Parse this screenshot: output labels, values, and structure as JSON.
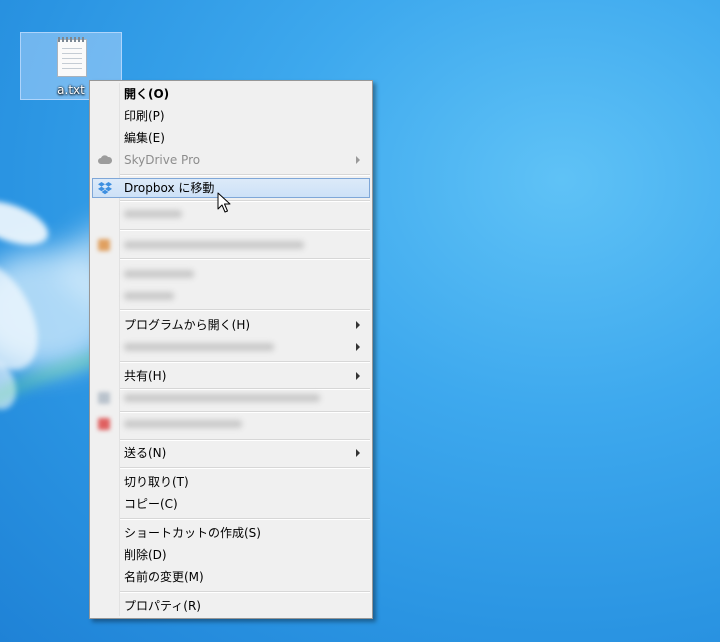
{
  "desktop": {
    "file": {
      "name": "a.txt",
      "icon": "text-file-icon"
    }
  },
  "context_menu": {
    "open": "開く(O)",
    "print": "印刷(P)",
    "edit": "編集(E)",
    "skydrive": "SkyDrive Pro",
    "dropbox": "Dropbox に移動",
    "open_with": "プログラムから開く(H)",
    "share": "共有(H)",
    "send_to": "送る(N)",
    "cut": "切り取り(T)",
    "copy": "コピー(C)",
    "create_shortcut": "ショートカットの作成(S)",
    "delete": "削除(D)",
    "rename": "名前の変更(M)",
    "properties": "プロパティ(R)"
  },
  "colors": {
    "highlight_bg": "#cde1f7",
    "highlight_border": "#7fa7d8",
    "menu_bg": "#f0f0f0",
    "desktop_blue": "#2a94e2"
  }
}
